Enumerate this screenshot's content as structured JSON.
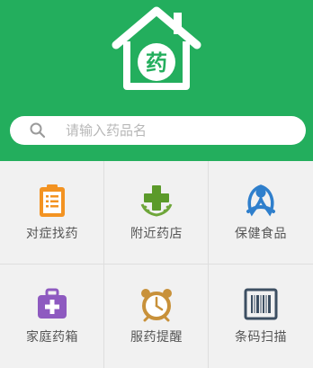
{
  "header": {
    "logo_icon": "house-medicine-icon",
    "logo_char": "药",
    "background_color": "#23ae5d"
  },
  "search": {
    "placeholder": "请输入药品名",
    "icon": "search-icon"
  },
  "menu": {
    "items": [
      {
        "label": "对症找药",
        "icon": "clipboard-icon"
      },
      {
        "label": "附近药店",
        "icon": "pharmacy-cross-icon"
      },
      {
        "label": "保健食品",
        "icon": "health-food-icon"
      },
      {
        "label": "家庭药箱",
        "icon": "medicine-kit-icon"
      },
      {
        "label": "服药提醒",
        "icon": "alarm-clock-icon"
      },
      {
        "label": "条码扫描",
        "icon": "barcode-icon"
      }
    ]
  }
}
